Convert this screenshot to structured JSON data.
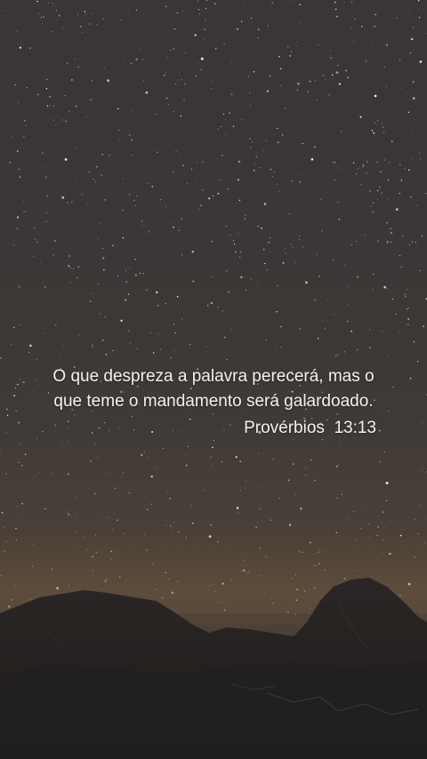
{
  "verse": {
    "line1": "O que despreza a palavra perecerá, mas o",
    "line2": "que teme o mandamento será galardoado.",
    "reference": "Provérbios  13:13"
  }
}
